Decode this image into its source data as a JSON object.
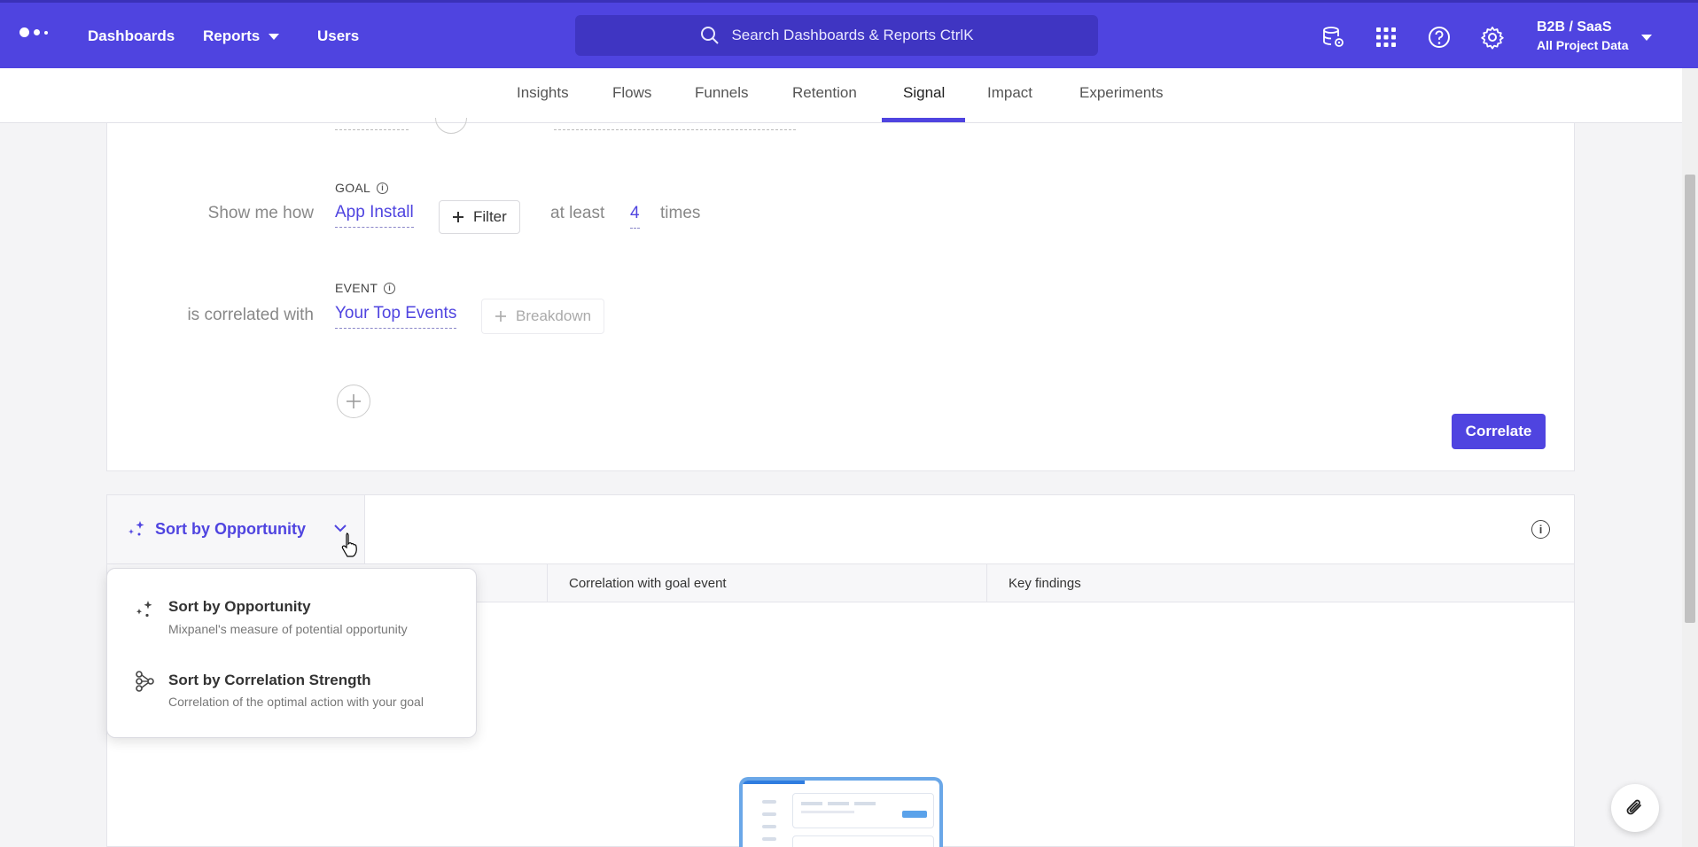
{
  "topbar": {
    "nav": [
      {
        "label": "Dashboards"
      },
      {
        "label": "Reports"
      },
      {
        "label": "Users"
      }
    ],
    "search_placeholder": "Search Dashboards & Reports CtrlK",
    "project_line1": "B2B / SaaS",
    "project_line2": "All Project Data"
  },
  "tabs": [
    "Insights",
    "Flows",
    "Funnels",
    "Retention",
    "Signal",
    "Impact",
    "Experiments"
  ],
  "active_tab": "Signal",
  "query": {
    "show_me_how_label": "Show me how",
    "goal_caption": "GOAL",
    "goal_value": "App Install",
    "filter_label": "Filter",
    "at_least_label": "at least",
    "times_value": "4",
    "times_label": "times",
    "correlated_label": "is correlated with",
    "event_caption": "EVENT",
    "event_value": "Your Top Events",
    "breakdown_label": "Breakdown",
    "correlate_button": "Correlate"
  },
  "results": {
    "sort_label": "Sort by Opportunity",
    "columns": [
      "Correlation with goal event",
      "Key findings"
    ]
  },
  "sort_menu": [
    {
      "title": "Sort by Opportunity",
      "subtitle": "Mixpanel's measure of potential opportunity"
    },
    {
      "title": "Sort by Correlation Strength",
      "subtitle": "Correlation of the optimal action with your goal"
    }
  ],
  "colors": {
    "brand": "#4f44e0"
  }
}
